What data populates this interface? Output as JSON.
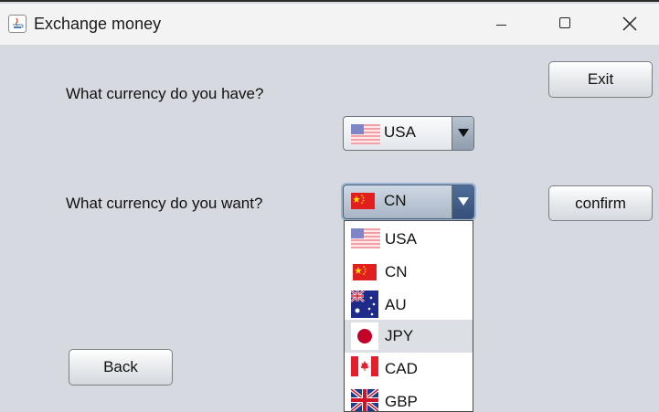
{
  "window": {
    "title": "Exchange money"
  },
  "form": {
    "have_label": "What currency do you have?",
    "want_label": "What currency do you want?",
    "have_selected": "USA",
    "want_selected": "CN"
  },
  "buttons": {
    "exit": "Exit",
    "confirm": "confirm",
    "back": "Back"
  },
  "dropdown": {
    "options": [
      "USA",
      "CN",
      "AU",
      "JPY",
      "CAD",
      "GBP"
    ],
    "highlighted": "JPY"
  },
  "icons": {
    "window": [
      "java-app-icon",
      "minimize-icon",
      "maximize-icon",
      "close-icon"
    ],
    "flags": [
      "usa-flag-icon",
      "cn-flag-icon",
      "au-flag-icon",
      "jpy-flag-icon",
      "cad-flag-icon",
      "gbp-flag-icon"
    ],
    "combo": "chevron-down-icon"
  },
  "colors": {
    "background": "#d6d9df",
    "titlebar": "#f3f3f3",
    "highlight": "#dcdfe4",
    "combo_active": "#35507a"
  }
}
